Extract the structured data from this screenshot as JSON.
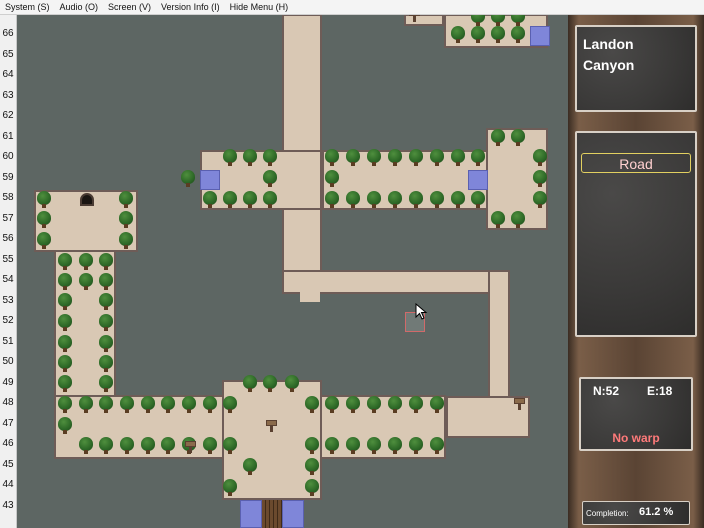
{
  "menu": {
    "items": [
      {
        "id": "system",
        "label": "System (S)"
      },
      {
        "id": "audio",
        "label": "Audio (O)"
      },
      {
        "id": "screen",
        "label": "Screen (V)"
      },
      {
        "id": "version",
        "label": "Version Info (I)"
      },
      {
        "id": "hide",
        "label": "Hide Menu (H)"
      }
    ]
  },
  "map": {
    "row_labels": [
      "66",
      "65",
      "64",
      "63",
      "62",
      "61",
      "60",
      "59",
      "58",
      "57",
      "56",
      "55",
      "54",
      "53",
      "52",
      "51",
      "50",
      "49",
      "48",
      "47",
      "46",
      "45",
      "44",
      "43"
    ],
    "colors": {
      "background": "#5d6663",
      "path": "#d9c8b4",
      "path_border": "#6e5c57",
      "water": "#7f86d9",
      "tree": "#2f6b28"
    }
  },
  "info": {
    "area_name_line1": "Landon",
    "area_name_line2": "Canyon",
    "terrain": "Road",
    "north": "N:52",
    "east": "E:18",
    "warp_status": "No warp",
    "completion_label": "Completion:",
    "completion_value": "61.2 %"
  }
}
